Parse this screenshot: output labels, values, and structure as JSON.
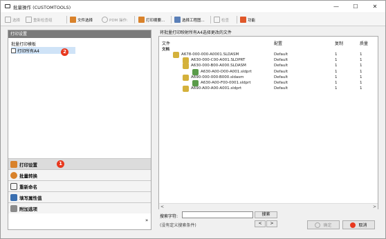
{
  "window": {
    "title": "批量操作 (CUSTOMTOOLS)",
    "minimize": "—",
    "maximize": "☐",
    "close": "✕"
  },
  "toolbar": {
    "items": [
      {
        "label": "选择",
        "disabled": true
      },
      {
        "label": "重新检查组",
        "disabled": true
      },
      {
        "label": "文件选择",
        "disabled": false
      },
      {
        "label": "PDM 操作:",
        "disabled": true
      },
      {
        "label": "打印摘要...",
        "disabled": false
      },
      {
        "label": "选择工程图...",
        "disabled": false
      },
      {
        "label": "检查",
        "disabled": true
      },
      {
        "label": "功能",
        "disabled": false
      }
    ]
  },
  "left": {
    "header": "打印设置",
    "subheader": "批量打印模板",
    "option_label": "打印所有A4",
    "badge_option": "2",
    "badge_nav": "1",
    "nav": [
      {
        "label": "打印设置",
        "color": "#d9822b"
      },
      {
        "label": "批量转换",
        "color": "#d9822b"
      },
      {
        "label": "重新命名",
        "color": "#444444"
      },
      {
        "label": "填写属性值",
        "color": "#3a6fb0"
      },
      {
        "label": "附加选项",
        "color": "#8a8a8a"
      }
    ],
    "chevron": "»"
  },
  "right": {
    "label": "将批量打印映射所有A4选择更改的文件",
    "columns": [
      "文件",
      "配置",
      "复制",
      "质量"
    ],
    "group_label": "文档",
    "rows": [
      {
        "file": "A678-000-000-A0001.SLDASM",
        "config": "Default",
        "copies": "1",
        "qty": "1"
      },
      {
        "file": "A630-000-C00-A001.SLDPRT",
        "config": "Default",
        "copies": "1",
        "qty": "1"
      },
      {
        "file": "A630-000-B00-A000.SLDASM",
        "config": "Default",
        "copies": "1",
        "qty": "1"
      },
      {
        "file": "A630-A00-D00-A001.sldprt",
        "config": "Default",
        "copies": "1",
        "qty": "1"
      },
      {
        "file": "A690-000-000-B000.sldasm",
        "config": "Default",
        "copies": "1",
        "qty": "1"
      },
      {
        "file": "A630-A00-F00-0001.sldprt",
        "config": "Default",
        "copies": "1",
        "qty": "1"
      },
      {
        "file": "A690-A00-A00-A001.sldprt",
        "config": "Default",
        "copies": "1",
        "qty": "1"
      }
    ],
    "scroll_left": "<",
    "scroll_right": ">"
  },
  "search": {
    "label": "搜索字符:",
    "placeholder": "",
    "button": "搜索",
    "hint": "(没有定义搜索条件)",
    "prev": "<",
    "next": ">"
  },
  "actions": {
    "ok": "确定",
    "cancel": "取消"
  },
  "colors": {
    "accent_red": "#e8381e",
    "selection": "#cfe3f7",
    "header_gray": "#7a7a7a"
  }
}
